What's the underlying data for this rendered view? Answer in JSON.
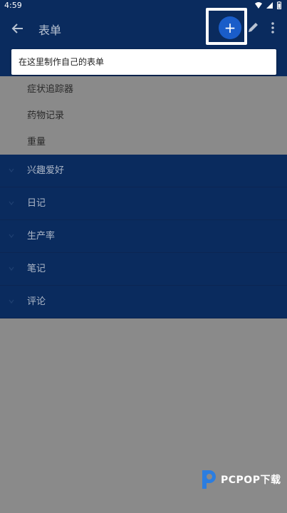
{
  "status": {
    "time": "4:59"
  },
  "toolbar": {
    "title": "表单",
    "add_label": "+"
  },
  "tooltip": {
    "text": "在这里制作自己的表单"
  },
  "grey_items": [
    {
      "label": "症状追踪器"
    },
    {
      "label": "药物记录"
    },
    {
      "label": "重量"
    }
  ],
  "blue_items": [
    {
      "label": "兴趣爱好"
    },
    {
      "label": "日记"
    },
    {
      "label": "生产率"
    },
    {
      "label": "笔记"
    },
    {
      "label": "评论"
    }
  ],
  "watermark": {
    "text": "PCPOP下载"
  }
}
